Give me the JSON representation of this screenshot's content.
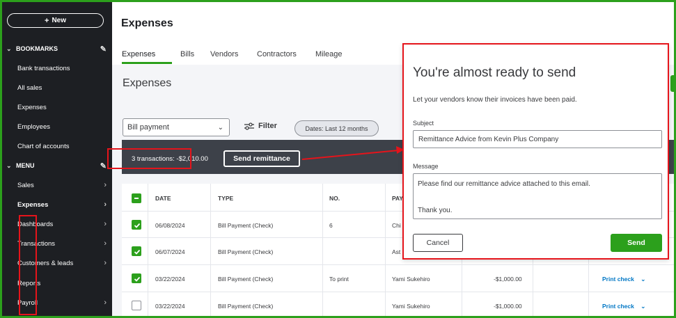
{
  "sidebar": {
    "new_label": "New",
    "bookmarks_label": "BOOKMARKS",
    "bookmarks": [
      "Bank transactions",
      "All sales",
      "Expenses",
      "Employees",
      "Chart of accounts"
    ],
    "menu_label": "MENU",
    "menu": [
      "Sales",
      "Expenses",
      "Dashboards",
      "Transactions",
      "Customers & leads",
      "Reports",
      "Payroll"
    ]
  },
  "header": {
    "title": "Expenses",
    "tabs": [
      "Expenses",
      "Bills",
      "Vendors",
      "Contractors",
      "Mileage"
    ],
    "section_title": "Expenses"
  },
  "filters": {
    "type_value": "Bill payment",
    "filter_label": "Filter",
    "date_pill": "Dates: Last 12 months"
  },
  "action_bar": {
    "summary": "3 transactions: -$2,010.00",
    "send_remittance": "Send remittance"
  },
  "table": {
    "columns": [
      "DATE",
      "TYPE",
      "NO.",
      "PAY"
    ],
    "rows": [
      {
        "date": "06/08/2024",
        "type": "Bill Payment (Check)",
        "no": "6",
        "payee": "Chi",
        "amount": "",
        "action": "",
        "checked": true
      },
      {
        "date": "06/07/2024",
        "type": "Bill Payment (Check)",
        "no": "",
        "payee": "Ast",
        "amount": "",
        "action": "",
        "checked": true
      },
      {
        "date": "03/22/2024",
        "type": "Bill Payment (Check)",
        "no": "To print",
        "payee": "Yami Sukehiro",
        "amount": "-$1,000.00",
        "action": "Print check",
        "checked": true
      },
      {
        "date": "03/22/2024",
        "type": "Bill Payment (Check)",
        "no": "",
        "payee": "Yami Sukehiro",
        "amount": "-$1,000.00",
        "action": "Print check",
        "checked": false
      }
    ]
  },
  "modal": {
    "title": "You're almost ready to send",
    "subtitle": "Let your vendors know their invoices have been paid.",
    "subject_label": "Subject",
    "subject_value": "Remittance Advice from Kevin Plus Company",
    "message_label": "Message",
    "message_value": "Please find our remittance advice attached to this email.\n\nThank you.",
    "cancel_label": "Cancel",
    "send_label": "Send"
  },
  "colors": {
    "accent": "#2ca01c",
    "highlight": "#e5141b",
    "sidebar_bg": "#1d1f23",
    "link": "#0077c5"
  }
}
